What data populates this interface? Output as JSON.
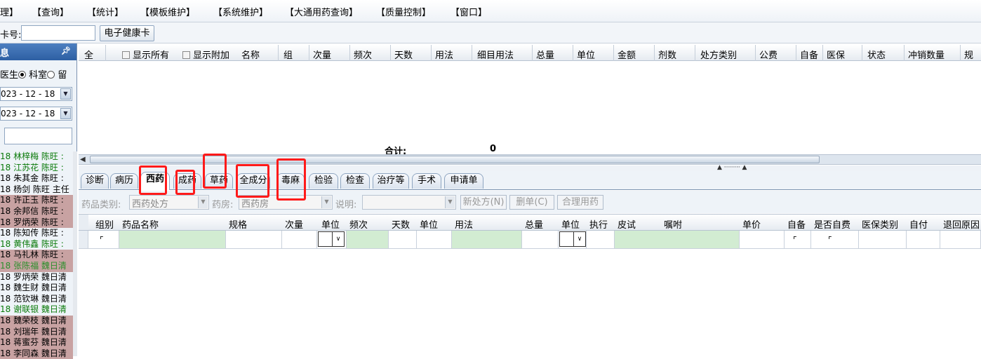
{
  "menu": [
    "理】",
    "【查询】",
    "【统计】",
    "【模板维护】",
    "【系统维护】",
    "【大通用药查询】",
    "【质量控制】",
    "【窗口】"
  ],
  "toolbar": {
    "card_label": "卡号:",
    "card_button": "电子健康卡"
  },
  "left": {
    "header": "息",
    "pin": "■",
    "radio_doctor": "医生",
    "radio_dept": "科室",
    "radio_stay": "留",
    "date1": "023 - 12 - 18",
    "date2": "023 - 12 - 18",
    "patients": [
      {
        "text": "18  林梓梅  陈旺  :",
        "style": "green"
      },
      {
        "text": "18  江苏花  陈旺  :",
        "style": "green"
      },
      {
        "text": "18  朱其金  陈旺  :",
        "style": "white"
      },
      {
        "text": "18  杨剑  陈旺  主任",
        "style": "white"
      },
      {
        "text": "18  许正玉  陈旺  :",
        "style": "pink"
      },
      {
        "text": "18  余邦信  陈旺  :",
        "style": "pink"
      },
      {
        "text": "18  罗炳荣  陈旺  :",
        "style": "pink"
      },
      {
        "text": "18  陈知传  陈旺  :",
        "style": "white"
      },
      {
        "text": "18  黄伟鑫  陈旺  :",
        "style": "green"
      },
      {
        "text": "18  马礼林  陈旺  :",
        "style": "pink"
      },
      {
        "text": "18  张陈福  魏日清",
        "style": "pinkgreen"
      },
      {
        "text": "18  罗炳荣  魏日清",
        "style": "white"
      },
      {
        "text": "18  魏生财  魏日清",
        "style": "white"
      },
      {
        "text": "18  范钦琳  魏日清",
        "style": "white"
      },
      {
        "text": "18  谢联银  魏日清",
        "style": "green"
      },
      {
        "text": "18  魏荣枝  魏日清",
        "style": "pink"
      },
      {
        "text": "18  刘瑞年  魏日清",
        "style": "pink"
      },
      {
        "text": "18  蒋蜜芬  魏日清",
        "style": "pink"
      },
      {
        "text": "18  李同森  魏日清",
        "style": "pink"
      }
    ]
  },
  "upper_grid": {
    "headers": [
      "全",
      "显示所有",
      "显示附加",
      "名称",
      "组",
      "次量",
      "频次",
      "天数",
      "用法",
      "细目用法",
      "总量",
      "单位",
      "金额",
      "剂数",
      "处方类别",
      "公费",
      "自备",
      "医保",
      "状态",
      "冲销数量",
      "规"
    ],
    "total_label": "合计:",
    "total_value": "0"
  },
  "tabs": [
    "诊断",
    "病历",
    "西药",
    "成药",
    "草药",
    "全成分",
    "毒麻",
    "检验",
    "检查",
    "治疗等",
    "手术",
    "申请单"
  ],
  "active_tab": "西药",
  "filter": {
    "category_label": "药品类别:",
    "category_value": "西药处方",
    "pharmacy_label": "药房:",
    "pharmacy_value": "西药房",
    "note_label": "说明:",
    "btn_new": "新处方(N)",
    "btn_delete": "删单(C)",
    "btn_rational": "合理用药"
  },
  "lower_grid": {
    "headers": [
      "组别",
      "药品名称",
      "规格",
      "次量",
      "单位",
      "频次",
      "天数",
      "单位",
      "用法",
      "总量",
      "单位",
      "执行",
      "皮试",
      "嘱咐",
      "单价",
      "自备",
      "是否自费",
      "医保类别",
      "自付",
      "退回原因"
    ],
    "checkmark": "⌜"
  }
}
